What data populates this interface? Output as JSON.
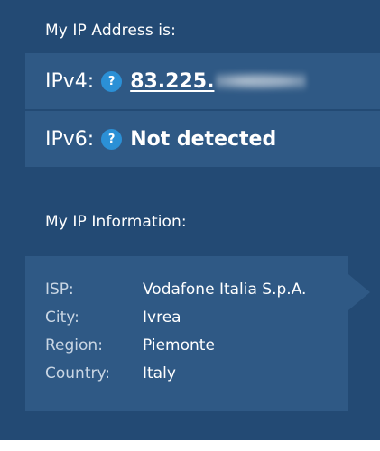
{
  "address": {
    "heading": "My IP Address is:",
    "ipv4": {
      "label": "IPv4:",
      "help": "?",
      "value": "83.225."
    },
    "ipv6": {
      "label": "IPv6:",
      "help": "?",
      "value": "Not detected"
    }
  },
  "info": {
    "heading": "My IP Information:",
    "rows": [
      {
        "key": "ISP:",
        "value": "Vodafone Italia S.p.A."
      },
      {
        "key": "City:",
        "value": "Ivrea"
      },
      {
        "key": "Region:",
        "value": "Piemonte"
      },
      {
        "key": "Country:",
        "value": "Italy"
      }
    ]
  },
  "colors": {
    "panel": "#234a74",
    "card": "#2f5985",
    "help_badge": "#2b90d6"
  },
  "icons": {
    "help": "question-circle-icon",
    "pointer": "arrow-right-icon"
  }
}
